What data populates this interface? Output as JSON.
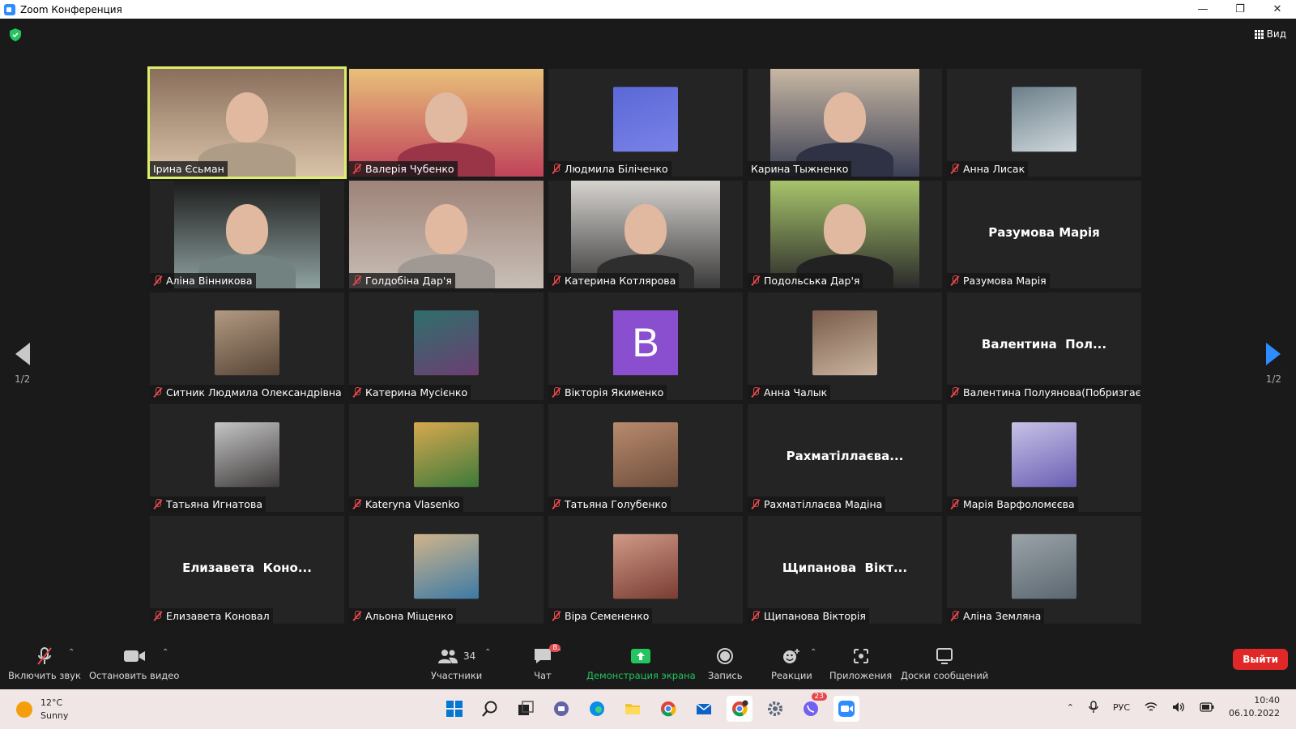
{
  "window": {
    "title": "Zoom Конференция"
  },
  "view_button": {
    "label": "Вид"
  },
  "pager": {
    "left": "1/2",
    "right": "1/2"
  },
  "colors": {
    "accent": "#2d8cff",
    "active_speaker": "#dcef6a",
    "mute": "#e5484d",
    "share": "#22c55e",
    "leave": "#e02828"
  },
  "participants": [
    {
      "name": "Ірина Єсьман",
      "type": "video",
      "muted": false,
      "active": true
    },
    {
      "name": "Валерія Чубенко",
      "type": "video",
      "muted": true
    },
    {
      "name": "Людмила  Біліченко",
      "type": "avatar",
      "muted": true
    },
    {
      "name": "Карина Тыжненко",
      "type": "video",
      "muted": false
    },
    {
      "name": "Анна Лисак",
      "type": "avatar",
      "muted": true
    },
    {
      "name": "Аліна Вінникова",
      "type": "video",
      "muted": true
    },
    {
      "name": "Голдобіна Дар'я",
      "type": "video",
      "muted": true
    },
    {
      "name": "Катерина Котлярова",
      "type": "video",
      "muted": true
    },
    {
      "name": "Подольська Дар'я",
      "type": "video",
      "muted": true
    },
    {
      "name": "Разумова Марія",
      "type": "name",
      "display": "Разумова Марія",
      "muted": true
    },
    {
      "name": "Ситник Людмила Олександрівна",
      "type": "avatar",
      "muted": true
    },
    {
      "name": "Катерина Мусієнко",
      "type": "avatar",
      "muted": true
    },
    {
      "name": "Вікторія Якименко",
      "type": "letter",
      "letter": "B",
      "muted": true
    },
    {
      "name": "Анна Чалык",
      "type": "avatar",
      "muted": true
    },
    {
      "name": "Валентина Полуянова(Побризгаєв...",
      "type": "name",
      "display": "Валентина  Пол...",
      "muted": true
    },
    {
      "name": "Татьяна Игнатова",
      "type": "avatar",
      "muted": true
    },
    {
      "name": "Kateryna Vlasenko",
      "type": "avatar",
      "muted": true
    },
    {
      "name": "Татьяна Голубенко",
      "type": "avatar",
      "muted": true
    },
    {
      "name": "Рахматіллаєва Мадіна",
      "type": "name",
      "display": "Рахматіллаєва...",
      "muted": true
    },
    {
      "name": "Марія Варфоломєєва",
      "type": "avatar",
      "muted": true
    },
    {
      "name": "Елизавета Коновал",
      "type": "name",
      "display": "Елизавета  Коно...",
      "muted": true
    },
    {
      "name": "Альона Міщенко",
      "type": "avatar",
      "muted": true
    },
    {
      "name": "Віра Семененко",
      "type": "avatar",
      "muted": true
    },
    {
      "name": "Щипанова Вікторія",
      "type": "name",
      "display": "Щипанова  Вікт...",
      "muted": true
    },
    {
      "name": "Аліна Земляна",
      "type": "avatar",
      "muted": true
    }
  ],
  "toolbar": {
    "unmute": "Включить звук",
    "video": "Остановить видео",
    "participants": "Участники",
    "participants_count": "34",
    "chat": "Чат",
    "chat_badge": "8",
    "share": "Демонстрация экрана",
    "record": "Запись",
    "reactions": "Реакции",
    "apps": "Приложения",
    "whiteboards": "Доски сообщений",
    "leave": "Выйти"
  },
  "taskbar": {
    "weather_temp": "12°C",
    "weather_desc": "Sunny",
    "lang": "РУС",
    "time": "10:40",
    "date": "06.10.2022",
    "viber_badge": "23"
  }
}
